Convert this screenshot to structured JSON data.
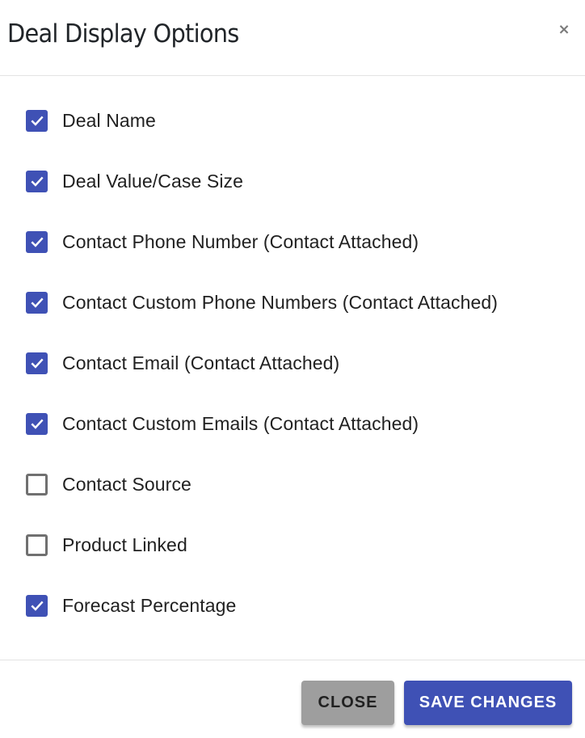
{
  "dialog": {
    "title": "Deal Display Options",
    "close_icon": "×"
  },
  "options": [
    {
      "label": "Deal Name",
      "checked": true
    },
    {
      "label": "Deal Value/Case Size",
      "checked": true
    },
    {
      "label": "Contact Phone Number (Contact Attached)",
      "checked": true
    },
    {
      "label": "Contact Custom Phone Numbers (Contact Attached)",
      "checked": true
    },
    {
      "label": "Contact Email (Contact Attached)",
      "checked": true
    },
    {
      "label": "Contact Custom Emails (Contact Attached)",
      "checked": true
    },
    {
      "label": "Contact Source",
      "checked": false
    },
    {
      "label": "Product Linked",
      "checked": false
    },
    {
      "label": "Forecast Percentage",
      "checked": true
    }
  ],
  "footer": {
    "close_label": "CLOSE",
    "save_label": "SAVE CHANGES"
  },
  "colors": {
    "accent": "#3f51b5",
    "close_button": "#9e9e9e"
  }
}
